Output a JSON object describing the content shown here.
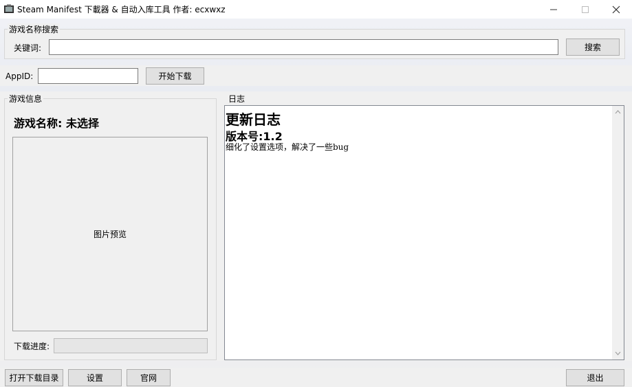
{
  "window": {
    "title": "Steam Manifest 下載器 & 自动入库工具 作者: ecxwxz"
  },
  "search_group": {
    "title": "游戏名称搜索",
    "keyword_label": "关键词:",
    "keyword_value": "",
    "search_button": "搜索"
  },
  "appid_row": {
    "label": "AppID:",
    "value": "",
    "start_button": "开始下载"
  },
  "game_info": {
    "title": "游戏信息",
    "game_name": "游戏名称: 未选择",
    "preview_label": "图片预览",
    "progress_label": "下载进度:",
    "progress": 0
  },
  "log": {
    "title": "日志",
    "heading": "更新日志",
    "version": "版本号:1.2",
    "entry": "细化了设置选项，解决了一些bug"
  },
  "bottom": {
    "open_dir": "打开下载目录",
    "settings": "设置",
    "website": "官网",
    "exit": "退出"
  }
}
